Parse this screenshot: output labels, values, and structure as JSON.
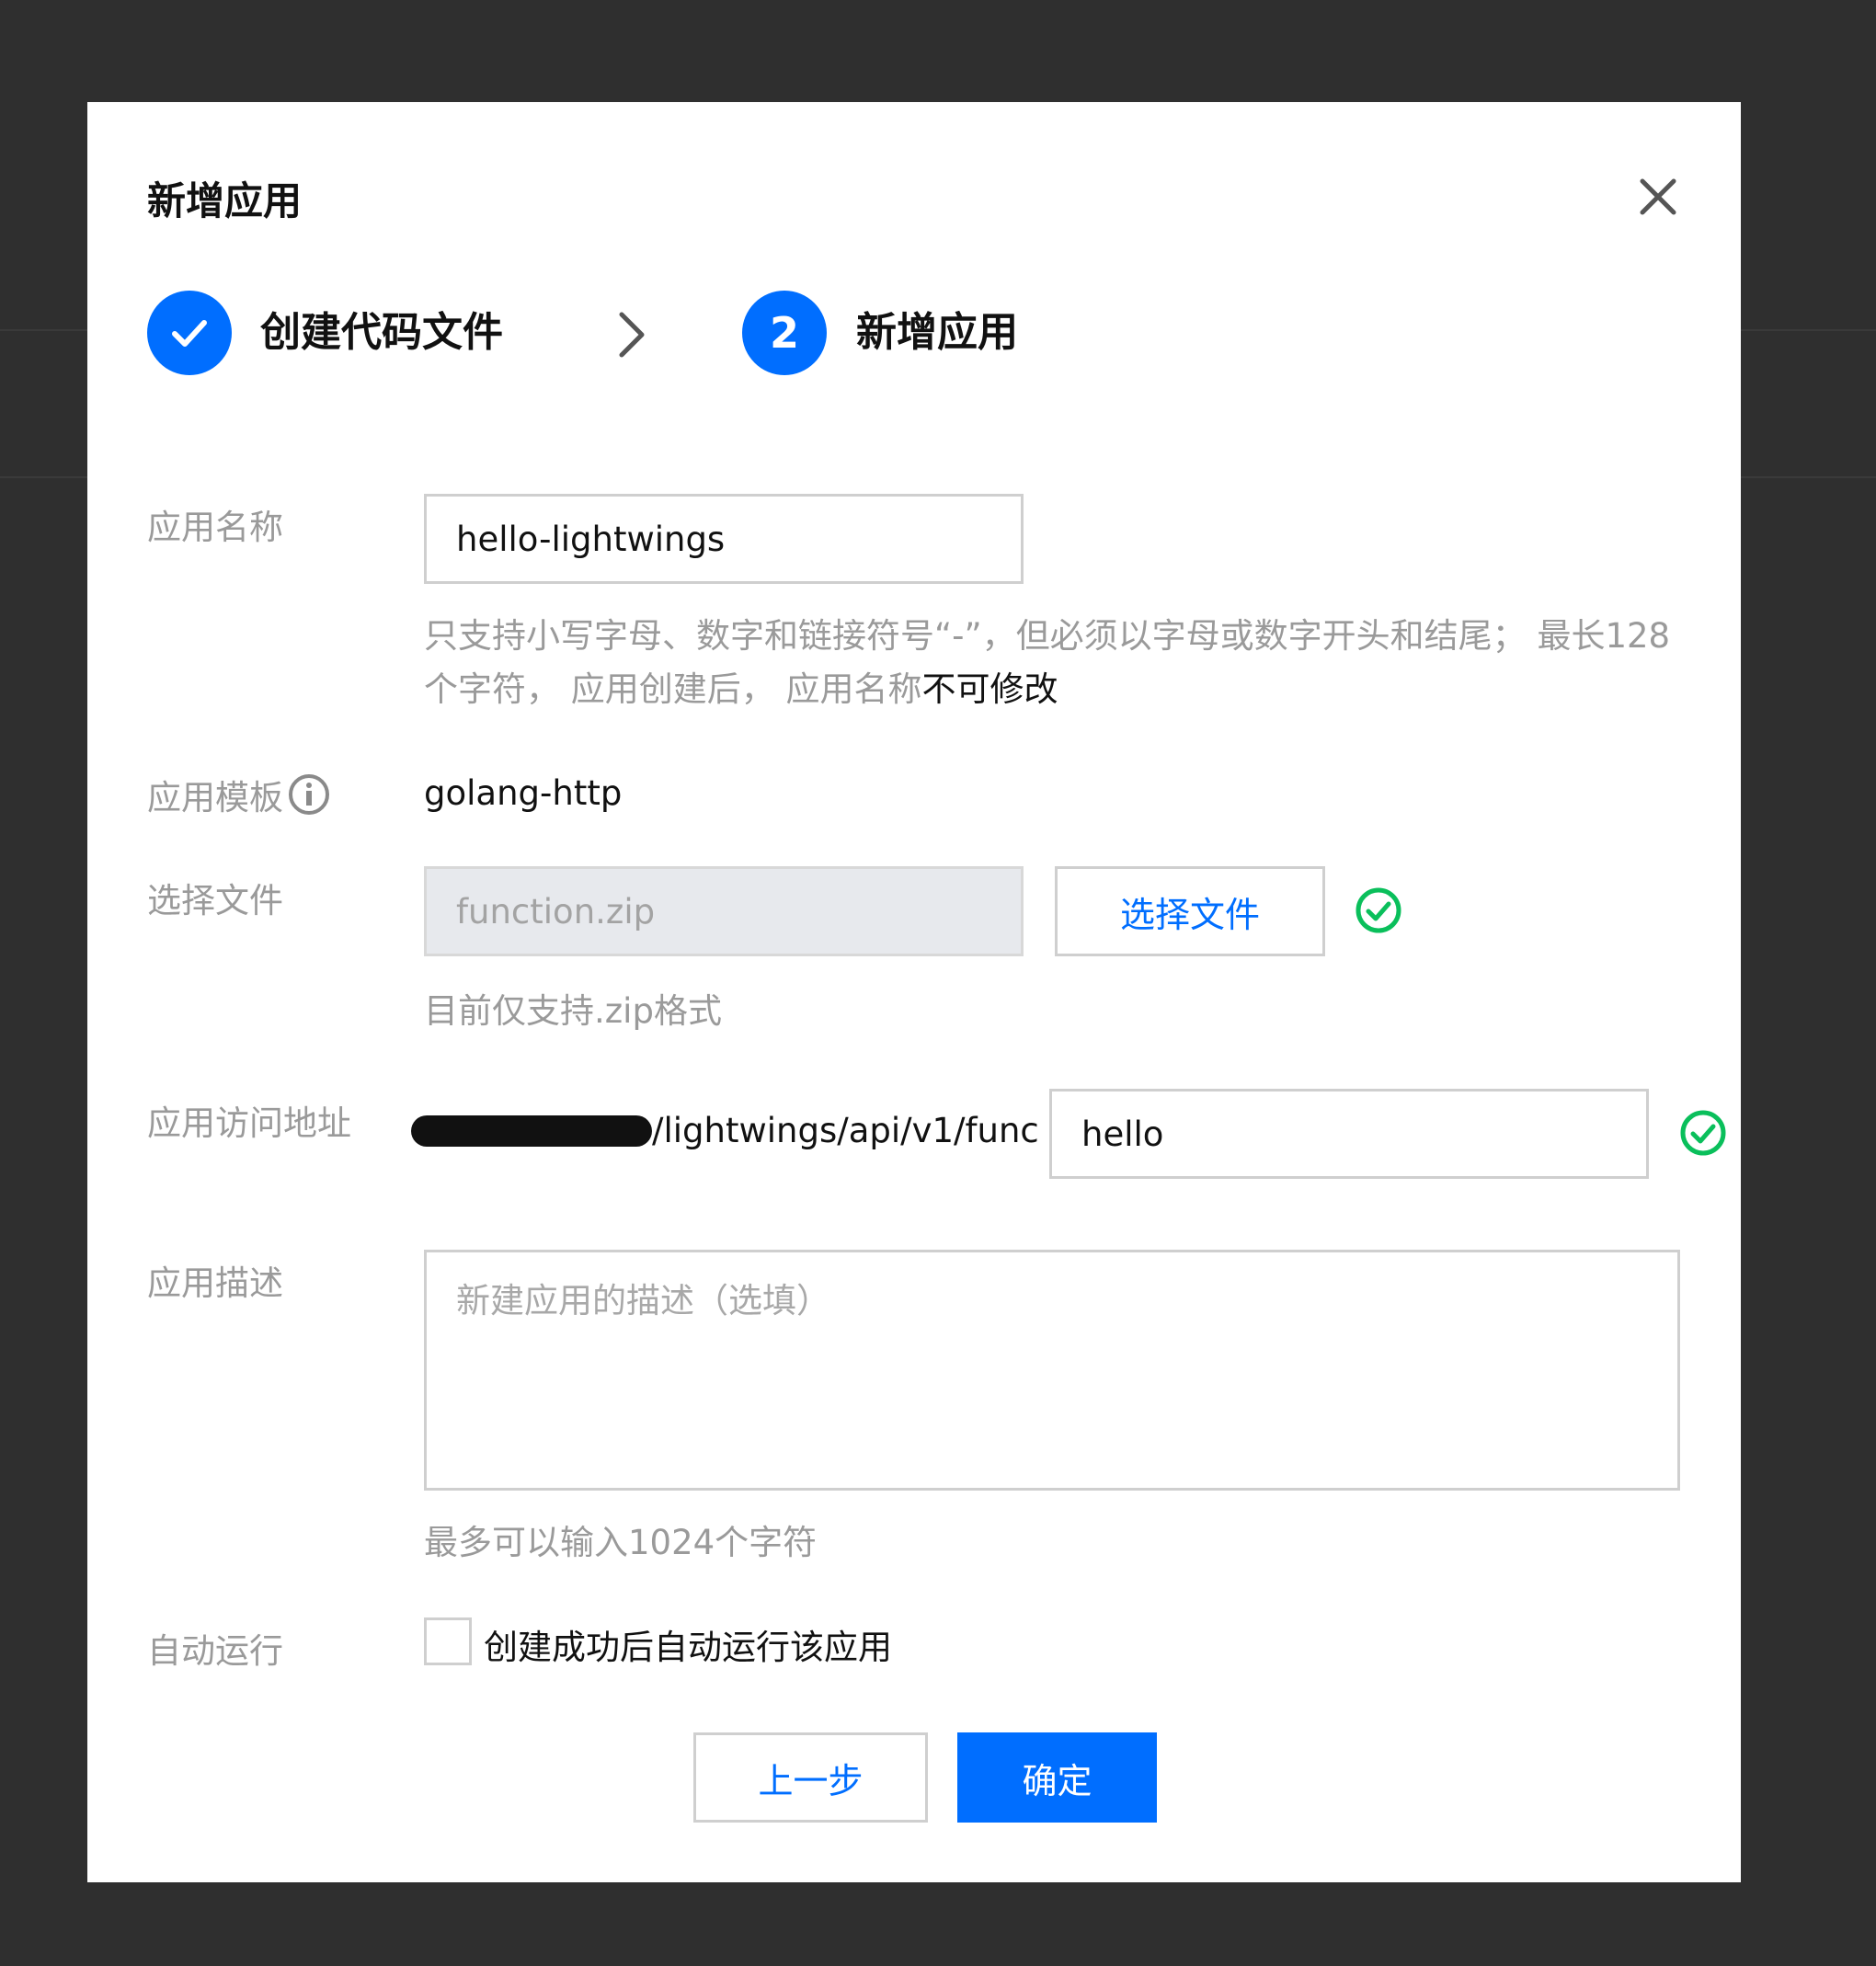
{
  "dialog": {
    "title": "新增应用",
    "close_icon": "close-icon"
  },
  "steps": [
    {
      "label": "创建代码文件",
      "state": "completed",
      "icon": "check-icon"
    },
    {
      "label": "新增应用",
      "state": "active",
      "number": "2"
    }
  ],
  "form": {
    "app_name": {
      "label": "应用名称",
      "value": "hello-lightwings",
      "hint_prefix": "只支持小写字母、数字和链接符号“-”，但必须以字母或数字开头和结尾； 最长128个字符， 应用创建后， 应用名称",
      "hint_emphasis": "不可修改"
    },
    "app_template": {
      "label": "应用模板",
      "info_icon": "info-icon",
      "value": "golang-http"
    },
    "file": {
      "label": "选择文件",
      "value": "function.zip",
      "button_label": "选择文件",
      "hint": "目前仅支持.zip格式",
      "status_icon": "check-circle-icon"
    },
    "access_url": {
      "label": "应用访问地址",
      "url_suffix": "/lightwings/api/v1/func",
      "path_value": "hello",
      "status_icon": "check-circle-icon"
    },
    "description": {
      "label": "应用描述",
      "placeholder": "新建应用的描述（选填）",
      "hint": "最多可以输入1024个字符"
    },
    "auto_run": {
      "label": "自动运行",
      "checkbox_label": "创建成功后自动运行该应用",
      "checked": false
    }
  },
  "footer": {
    "prev_label": "上一步",
    "confirm_label": "确定"
  },
  "colors": {
    "primary": "#006eff",
    "success": "#0abf5b",
    "overlay": "#2f2f2f"
  }
}
